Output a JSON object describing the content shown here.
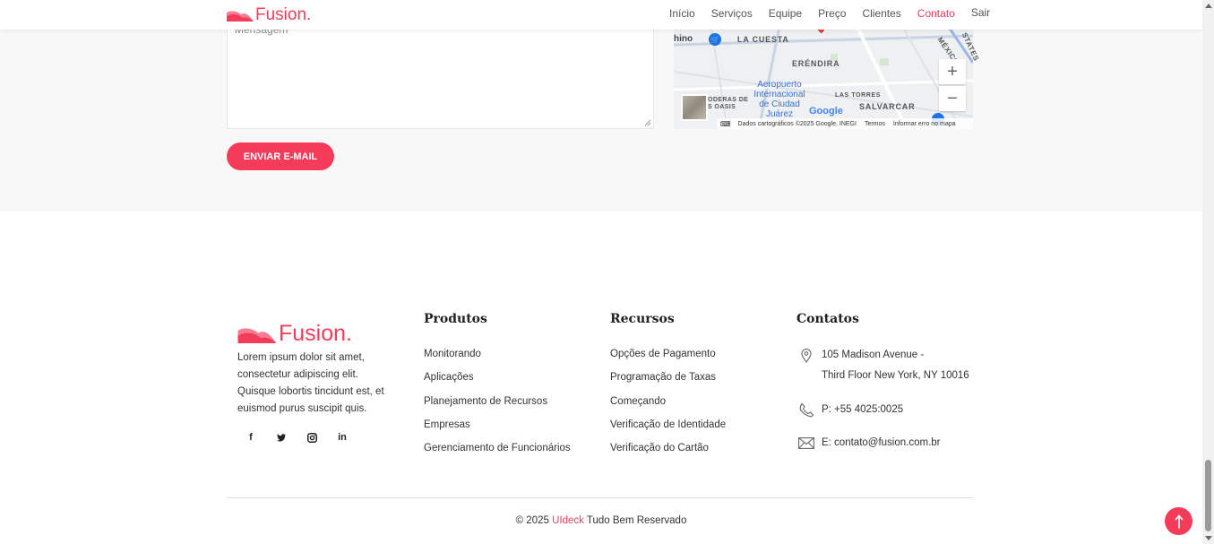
{
  "header": {
    "brand": "Fusion.",
    "nav": [
      {
        "label": "Início"
      },
      {
        "label": "Serviços"
      },
      {
        "label": "Equipe"
      },
      {
        "label": "Preço"
      },
      {
        "label": "Clientes"
      },
      {
        "label": "Contato",
        "active": true
      },
      {
        "label": "Sair"
      }
    ]
  },
  "contact_form": {
    "message_placeholder": "Mensagem",
    "send_label": "ENVIAR E-MAIL"
  },
  "map": {
    "labels": {
      "top_left": "hino",
      "la_cuesta": "LA CUESTA",
      "erendira": "ERÉNDIRA",
      "las_torres": "LAS TORRES",
      "salvarcar": "SALVARCAR",
      "oasis": "ODERAS DE\nS OASIS",
      "mexico": "MÉXICO",
      "states": "STATES"
    },
    "airport": "Aeropuerto\nInternacional\nde Ciudad\nJuárez",
    "google": "Google",
    "attribution": "Dados cartográficos ©2025 Google, INEGI",
    "terms": "Termos",
    "report": "Informar erro no mapa",
    "zoom_in": "+",
    "zoom_out": "−"
  },
  "footer": {
    "brand": "Fusion.",
    "about": "Lorem ipsum dolor sit amet, consectetur adipiscing elit. Quisque lobortis tincidunt est, et euismod purus suscipit quis.",
    "social": [
      "f",
      "t",
      "ig",
      "in"
    ],
    "produtos": {
      "title": "Produtos",
      "items": [
        "Monitorando",
        "Aplicações",
        "Planejamento de Recursos",
        "Empresas",
        "Gerenciamento de Funcionários"
      ]
    },
    "recursos": {
      "title": "Recursos",
      "items": [
        "Opções de Pagamento",
        "Programação de Taxas",
        "Começando",
        "Verificação de Identidade",
        "Verificação do Cartão"
      ]
    },
    "contatos": {
      "title": "Contatos",
      "address_1": "105 Madison Avenue -",
      "address_2": "Third Floor New York, NY 10016",
      "phone": "P: +55 4025:0025",
      "email": "E: contato@fusion.com.br"
    },
    "copyright_prefix": "© 2025",
    "copyright_brand": "UIdeck",
    "copyright_suffix": "Tudo Bem Reservado"
  },
  "colors": {
    "accent": "#f43b5a",
    "section_bg": "#f8f8f8"
  }
}
